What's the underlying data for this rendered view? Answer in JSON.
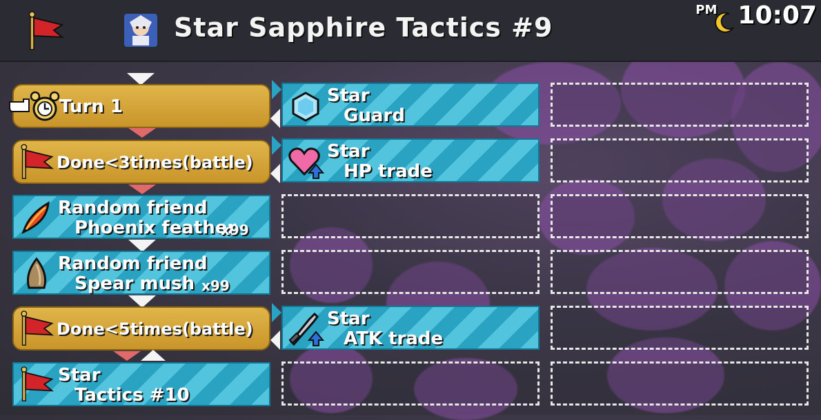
{
  "header": {
    "title": "Star Sapphire Tactics #9",
    "clock_period": "PM",
    "clock_time": "10:07"
  },
  "rows": [
    {
      "condition": "Turn 1",
      "action_line1": "Star",
      "action_line2": "Guard"
    },
    {
      "condition": "Done<3times(battle)",
      "action_line1": "Star",
      "action_line2": "HP trade"
    },
    {
      "condition_line1": "Random friend",
      "condition_line2": "Phoenix feather",
      "condition_count": "x99"
    },
    {
      "condition_line1": "Random friend",
      "condition_line2": "Spear mush",
      "condition_count": "x99"
    },
    {
      "condition": "Done<5times(battle)",
      "action_line1": "Star",
      "action_line2": "ATK trade"
    },
    {
      "condition_line1": "Star",
      "condition_line2": "Tactics #10"
    }
  ],
  "colors": {
    "gold": "#d4a43a",
    "blue_stripe": "#2aa3c3",
    "header": "#2b2b33"
  }
}
